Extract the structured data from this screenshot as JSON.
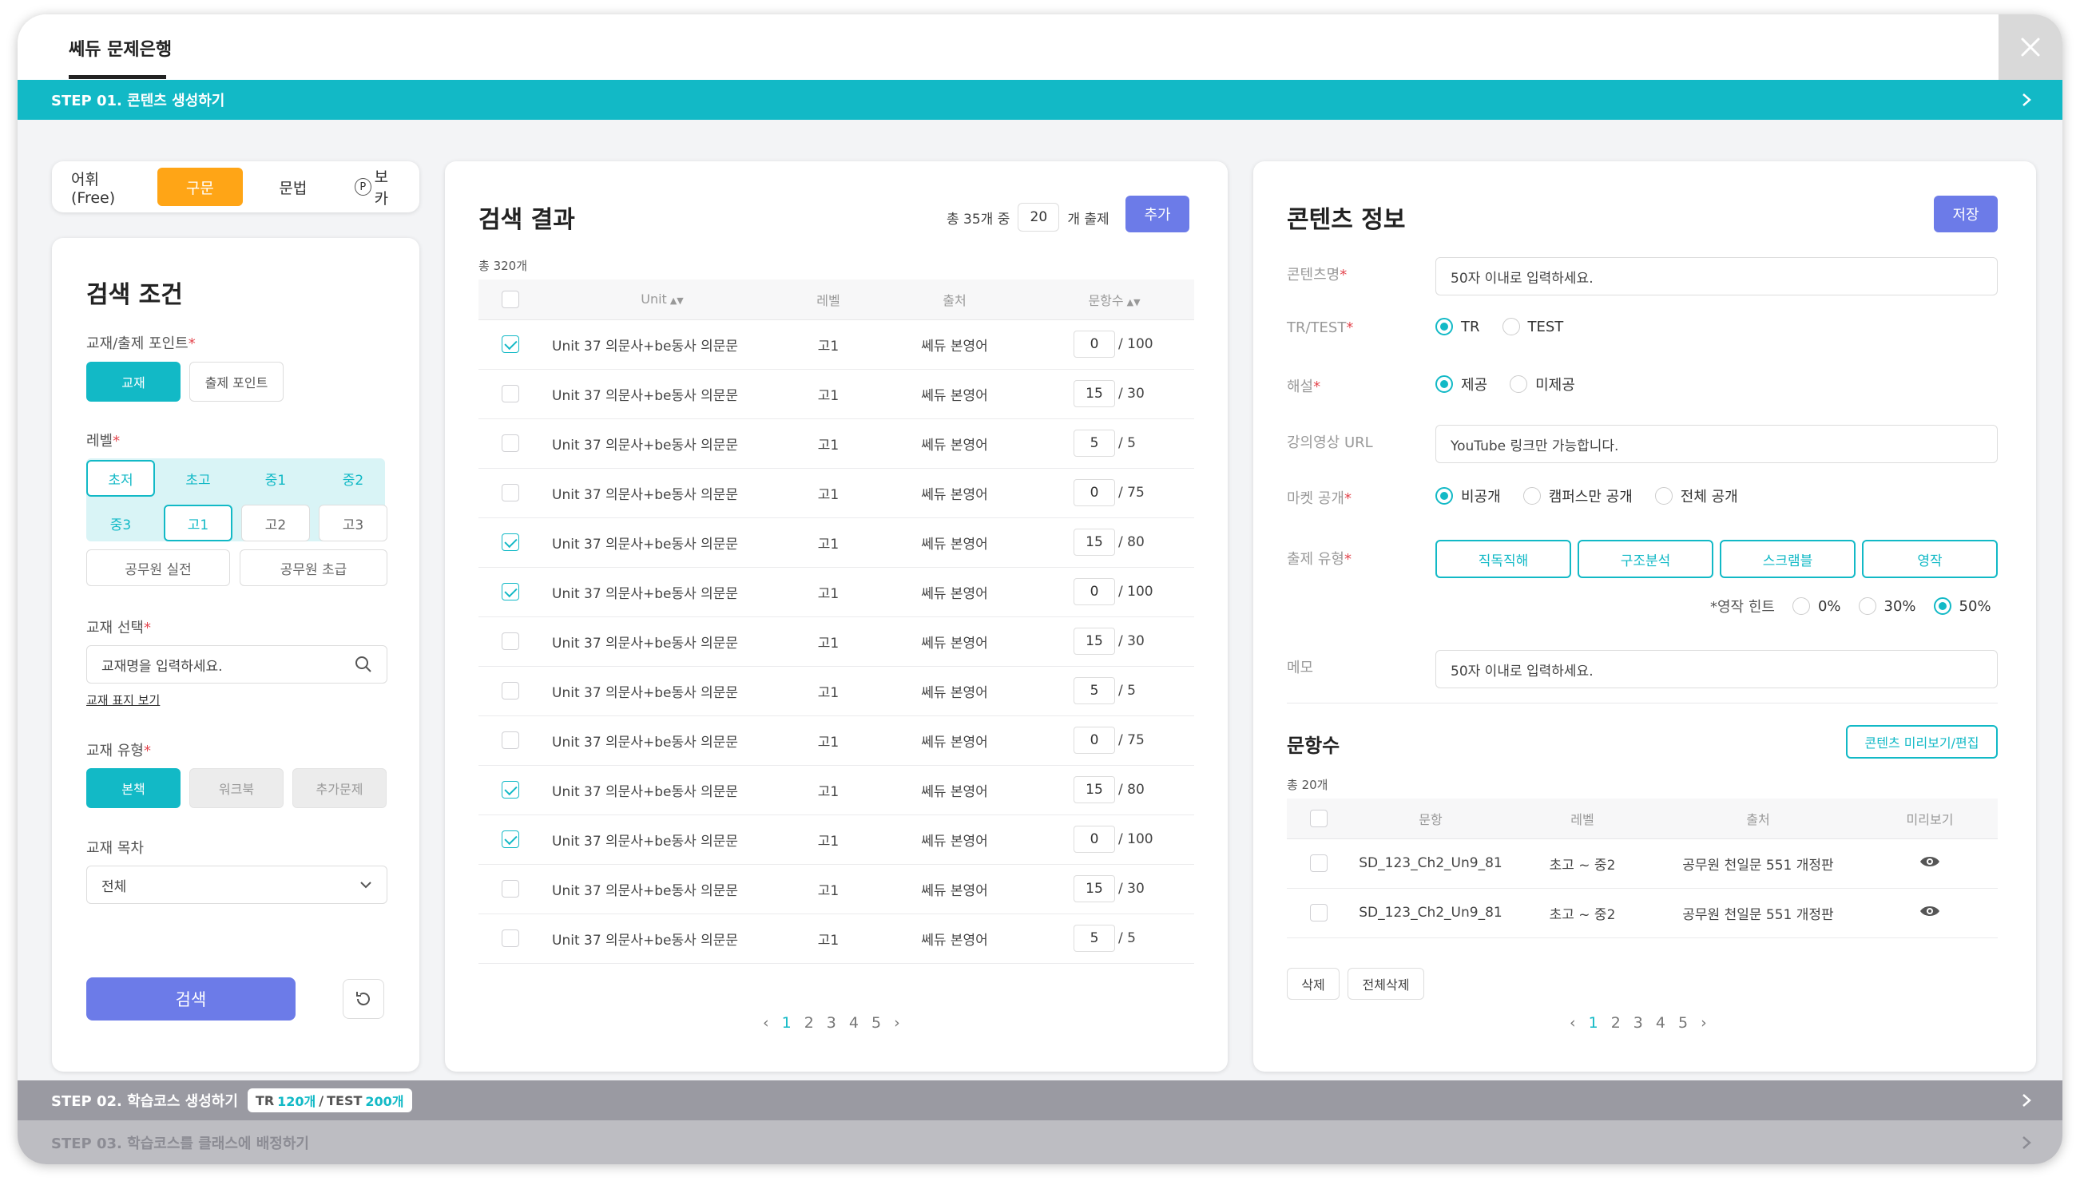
{
  "header": {
    "tab_label": "쎄듀 문제은행"
  },
  "steps": {
    "step1": "STEP 01. 콘텐츠 생성하기",
    "step2": "STEP 02. 학습코스 생성하기",
    "step2_badge": {
      "tr_prefix": "TR",
      "tr_value": "120개",
      "sep": "/",
      "test_prefix": "TEST",
      "test_value": "200개"
    },
    "step3": "STEP 03. 학습코스를 클래스에 배정하기"
  },
  "category_tabs": [
    {
      "label": "어휘(Free)",
      "active": false
    },
    {
      "label": "구문",
      "active": true
    },
    {
      "label": "문법",
      "active": false
    },
    {
      "label": "보카",
      "active": false,
      "icon": "P"
    }
  ],
  "search": {
    "title": "검색 조건",
    "point_label": "교재/출제 포인트",
    "point_options": [
      "교재",
      "출제 포인트"
    ],
    "level_label": "레벨",
    "levels_row1": [
      "초저",
      "초고",
      "중1",
      "중2"
    ],
    "levels_row2": [
      "중3",
      "고1",
      "고2",
      "고3"
    ],
    "levels_row3": [
      "공무원 실전",
      "공무원 초급"
    ],
    "book_label": "교재 선택",
    "book_placeholder": "교재명을 입력하세요.",
    "book_cover_link": "교재 표지 보기",
    "type_label": "교재 유형",
    "type_options": [
      "본책",
      "워크북",
      "추가문제"
    ],
    "toc_label": "교재 목차",
    "toc_value": "전체",
    "search_button": "검색"
  },
  "results": {
    "title": "검색 결과",
    "summary_prefix": "총 35개 중",
    "summary_count": "20",
    "summary_suffix": "개 출제",
    "add_button": "추가",
    "total": "총 320개",
    "columns": [
      "Unit",
      "레벨",
      "출처",
      "문항수"
    ],
    "rows": [
      {
        "checked": true,
        "unit": "Unit 37 의문사+be동사 의문문",
        "level": "고1",
        "source": "쎄듀 본영어",
        "count": "0",
        "total": "/ 100"
      },
      {
        "checked": false,
        "unit": "Unit 37 의문사+be동사 의문문",
        "level": "고1",
        "source": "쎄듀 본영어",
        "count": "15",
        "total": "/ 30"
      },
      {
        "checked": false,
        "unit": "Unit 37 의문사+be동사 의문문",
        "level": "고1",
        "source": "쎄듀 본영어",
        "count": "5",
        "total": "/ 5"
      },
      {
        "checked": false,
        "unit": "Unit 37 의문사+be동사 의문문",
        "level": "고1",
        "source": "쎄듀 본영어",
        "count": "0",
        "total": "/ 75"
      },
      {
        "checked": true,
        "unit": "Unit 37 의문사+be동사 의문문",
        "level": "고1",
        "source": "쎄듀 본영어",
        "count": "15",
        "total": "/ 80"
      },
      {
        "checked": true,
        "unit": "Unit 37 의문사+be동사 의문문",
        "level": "고1",
        "source": "쎄듀 본영어",
        "count": "0",
        "total": "/ 100"
      },
      {
        "checked": false,
        "unit": "Unit 37 의문사+be동사 의문문",
        "level": "고1",
        "source": "쎄듀 본영어",
        "count": "15",
        "total": "/ 30"
      },
      {
        "checked": false,
        "unit": "Unit 37 의문사+be동사 의문문",
        "level": "고1",
        "source": "쎄듀 본영어",
        "count": "5",
        "total": "/ 5"
      },
      {
        "checked": false,
        "unit": "Unit 37 의문사+be동사 의문문",
        "level": "고1",
        "source": "쎄듀 본영어",
        "count": "0",
        "total": "/ 75"
      },
      {
        "checked": true,
        "unit": "Unit 37 의문사+be동사 의문문",
        "level": "고1",
        "source": "쎄듀 본영어",
        "count": "15",
        "total": "/ 80"
      },
      {
        "checked": true,
        "unit": "Unit 37 의문사+be동사 의문문",
        "level": "고1",
        "source": "쎄듀 본영어",
        "count": "0",
        "total": "/ 100"
      },
      {
        "checked": false,
        "unit": "Unit 37 의문사+be동사 의문문",
        "level": "고1",
        "source": "쎄듀 본영어",
        "count": "15",
        "total": "/ 30"
      },
      {
        "checked": false,
        "unit": "Unit 37 의문사+be동사 의문문",
        "level": "고1",
        "source": "쎄듀 본영어",
        "count": "5",
        "total": "/ 5"
      }
    ],
    "pages": [
      "1",
      "2",
      "3",
      "4",
      "5"
    ],
    "current_page": "1"
  },
  "info": {
    "title": "콘텐츠 정보",
    "save_button": "저장",
    "name_label": "콘텐츠명",
    "name_placeholder": "50자 이내로 입력하세요.",
    "trtest_label": "TR/TEST",
    "trtest_options": [
      "TR",
      "TEST"
    ],
    "explain_label": "해설",
    "explain_options": [
      "제공",
      "미제공"
    ],
    "video_label": "강의영상 URL",
    "video_placeholder": "YouTube 링크만 가능합니다.",
    "market_label": "마켓 공개",
    "market_options": [
      "비공개",
      "캠퍼스만 공개",
      "전체 공개"
    ],
    "qtype_label": "출제 유형",
    "qtype_options": [
      "직독직해",
      "구조분석",
      "스크램블",
      "영작"
    ],
    "hint_label": "*영작 힌트",
    "hint_options": [
      "0%",
      "30%",
      "50%"
    ],
    "memo_label": "메모",
    "memo_placeholder": "50자 이내로 입력하세요.",
    "questions_title": "문항수",
    "preview_button": "콘텐츠 미리보기/편집",
    "questions_total": "총 20개",
    "q_columns": [
      "문항",
      "레벨",
      "출처",
      "미리보기"
    ],
    "q_rows": [
      {
        "item": "SD_123_Ch2_Un9_81",
        "level": "초고 ~ 중2",
        "source": "공무원 천일문 551 개정판"
      },
      {
        "item": "SD_123_Ch2_Un9_81",
        "level": "초고 ~ 중2",
        "source": "공무원 천일문 551 개정판"
      }
    ],
    "delete_button": "삭제",
    "delete_all_button": "전체삭제",
    "pages": [
      "1",
      "2",
      "3",
      "4",
      "5"
    ],
    "current_page": "1"
  },
  "colors": {
    "teal": "#12b9c6",
    "orange": "#ffa516",
    "indigo": "#6c7be8",
    "required": "#e4474f"
  }
}
